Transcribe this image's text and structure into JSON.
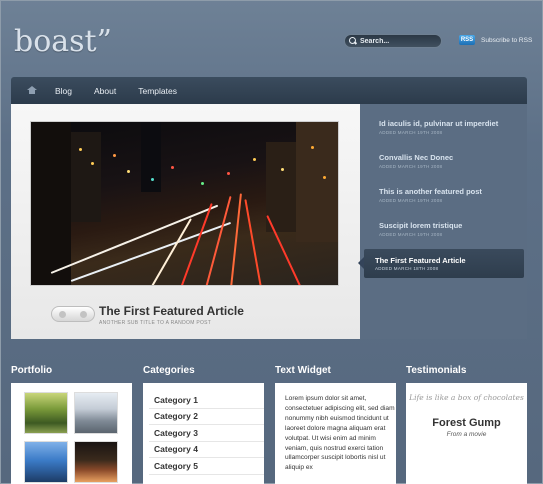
{
  "header": {
    "logo": "boast”",
    "search_placeholder": "Search...",
    "rss_badge": "RSS",
    "subscribe": "Subscribe to RSS"
  },
  "nav": {
    "items": [
      "Blog",
      "About",
      "Templates"
    ]
  },
  "featured": {
    "title": "The First Featured Article",
    "subtitle": "ANOTHER SUB TITLE TO A RANDOM POST",
    "list": [
      {
        "title": "Id iaculis id, pulvinar ut imperdiet",
        "date": "ADDED MARCH 19TH 2008"
      },
      {
        "title": "Convallis Nec Donec",
        "date": "ADDED MARCH 19TH 2008"
      },
      {
        "title": "This is another featured post",
        "date": "ADDED MARCH 19TH 2008"
      },
      {
        "title": "Suscipit lorem tristique",
        "date": "ADDED MARCH 19TH 2008"
      }
    ],
    "active": {
      "title": "The First Featured Article",
      "date": "ADDED MARCH 18TH 2008"
    }
  },
  "portfolio": {
    "heading": "Portfolio"
  },
  "categories": {
    "heading": "Categories",
    "items": [
      "Category 1",
      "Category 2",
      "Category 3",
      "Category 4",
      "Category 5"
    ]
  },
  "text_widget": {
    "heading": "Text Widget",
    "body": "Lorem ipsum dolor sit amet, consectetuer adipiscing elit, sed diam nonummy nibh euismod tincidunt ut laoreet dolore magna aliquam erat volutpat. Ut wisi enim ad minim veniam, quis nostrud exerci tation ullamcorper suscipit lobortis nisl ut aliquip ex"
  },
  "testimonials": {
    "heading": "Testimonials",
    "quote": "Life is like a box of chocolates",
    "name": "Forest Gump",
    "source": "From a movie"
  }
}
